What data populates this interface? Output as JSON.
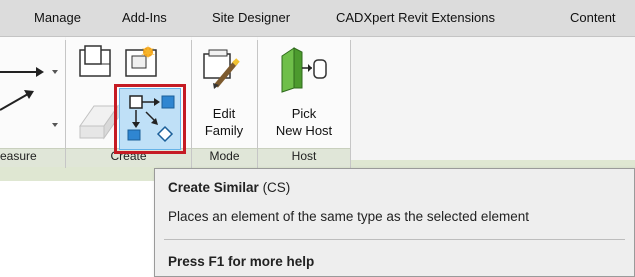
{
  "tabs": [
    "Manage",
    "Add-Ins",
    "Site Designer",
    "CADXpert Revit Extensions",
    "Content"
  ],
  "panels": {
    "measure": "easure",
    "create": "Create",
    "mode": "Mode",
    "host": "Host"
  },
  "buttons": {
    "edit_family": [
      "Edit",
      "Family"
    ],
    "pick_new_host": [
      "Pick",
      "New Host"
    ]
  },
  "tooltip": {
    "title": "Create Similar",
    "shortcut": "(CS)",
    "description": "Places an element of the same type as the selected element",
    "help": "Press F1 for more help"
  },
  "colors": {
    "highlight": "#c51b24",
    "selected_button": "#bfe0f7"
  }
}
